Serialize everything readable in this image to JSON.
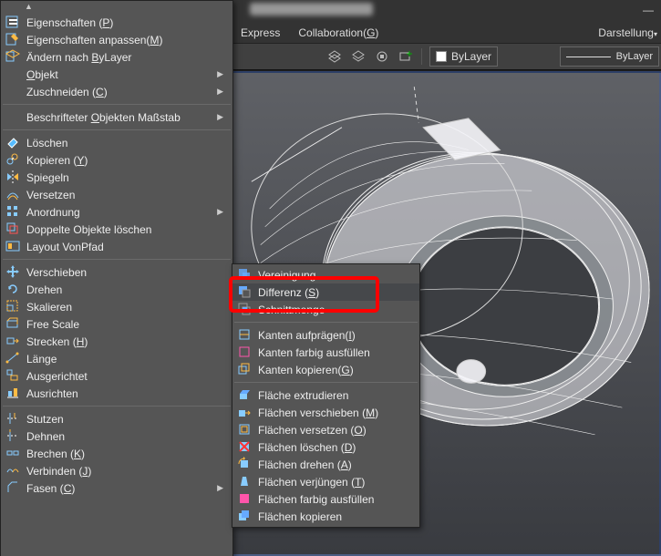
{
  "title_blurred": "(obscured document title)",
  "menubar": {
    "express": "Express",
    "collab": "Collaboration(G)",
    "darstellung": "Darstellung"
  },
  "toolbar": {
    "layer_box": "ByLayer",
    "right_box": "ByLayer"
  },
  "ctx_menu": [
    {
      "type": "item",
      "icon": "props",
      "label": "Eigenschaften (P)"
    },
    {
      "type": "item",
      "icon": "props-edit",
      "label": "Eigenschaften anpassen(M)"
    },
    {
      "type": "item",
      "icon": "bylayer",
      "label": "Ändern nach ByLayer"
    },
    {
      "type": "item",
      "label": "Objekt",
      "arrow": true
    },
    {
      "type": "item",
      "label": "Zuschneiden (C)",
      "arrow": true
    },
    {
      "type": "sep"
    },
    {
      "type": "item",
      "label": "Beschrifteter Objekten Maßstab",
      "arrow": true
    },
    {
      "type": "sep"
    },
    {
      "type": "item",
      "icon": "erase",
      "label": "Löschen"
    },
    {
      "type": "item",
      "icon": "copy",
      "label": "Kopieren (Y)"
    },
    {
      "type": "item",
      "icon": "mirror",
      "label": "Spiegeln"
    },
    {
      "type": "item",
      "icon": "offset",
      "label": "Versetzen"
    },
    {
      "type": "item",
      "icon": "array",
      "label": "Anordnung",
      "arrow": true
    },
    {
      "type": "item",
      "icon": "overkill",
      "label": "Doppelte Objekte löschen"
    },
    {
      "type": "item",
      "icon": "layout",
      "label": "Layout VonPfad"
    },
    {
      "type": "sep"
    },
    {
      "type": "item",
      "icon": "move",
      "label": "Verschieben"
    },
    {
      "type": "item",
      "icon": "rotate",
      "label": "Drehen"
    },
    {
      "type": "item",
      "icon": "scale",
      "label": "Skalieren"
    },
    {
      "type": "item",
      "icon": "freescale",
      "label": "Free Scale"
    },
    {
      "type": "item",
      "icon": "stretch",
      "label": "Strecken (H)"
    },
    {
      "type": "item",
      "icon": "length",
      "label": "Länge"
    },
    {
      "type": "item",
      "icon": "align",
      "label": "Ausgerichtet"
    },
    {
      "type": "item",
      "icon": "align3",
      "label": "Ausrichten"
    },
    {
      "type": "sep"
    },
    {
      "type": "item",
      "icon": "trim",
      "label": "Stutzen"
    },
    {
      "type": "item",
      "icon": "extend",
      "label": "Dehnen"
    },
    {
      "type": "item",
      "icon": "break",
      "label": "Brechen (K)"
    },
    {
      "type": "item",
      "icon": "join",
      "label": "Verbinden (J)"
    },
    {
      "type": "item",
      "icon": "chamfer",
      "label": "Fasen (C)",
      "arrow": true
    }
  ],
  "submenu": [
    {
      "type": "item",
      "icon": "union",
      "label": "Vereinigung"
    },
    {
      "type": "item",
      "icon": "subtract",
      "label": "Differenz (S)",
      "hl": true
    },
    {
      "type": "item",
      "icon": "intersect",
      "label": "Schnittmenge"
    },
    {
      "type": "sep"
    },
    {
      "type": "item",
      "icon": "imprint",
      "label": "Kanten aufprägen(I)"
    },
    {
      "type": "item",
      "icon": "coloredges",
      "label": "Kanten farbig ausfüllen"
    },
    {
      "type": "item",
      "icon": "copyedges",
      "label": "Kanten kopieren(G)"
    },
    {
      "type": "sep"
    },
    {
      "type": "item",
      "icon": "extrudef",
      "label": "Fläche extrudieren"
    },
    {
      "type": "item",
      "icon": "movef",
      "label": "Flächen verschieben (M)"
    },
    {
      "type": "item",
      "icon": "offsetf",
      "label": "Flächen versetzen (O)"
    },
    {
      "type": "item",
      "icon": "deletef",
      "label": "Flächen löschen (D)"
    },
    {
      "type": "item",
      "icon": "rotatef",
      "label": "Flächen drehen (A)"
    },
    {
      "type": "item",
      "icon": "taperf",
      "label": "Flächen verjüngen (T)"
    },
    {
      "type": "item",
      "icon": "colorf",
      "label": "Flächen farbig ausfüllen"
    },
    {
      "type": "item",
      "icon": "copyf",
      "label": "Flächen kopieren"
    }
  ]
}
